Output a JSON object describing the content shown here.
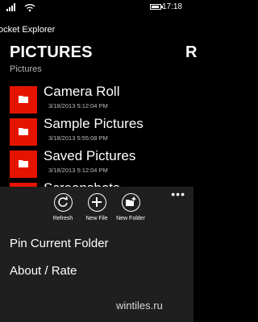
{
  "status": {
    "time": "17:18",
    "battery_level": 0.85
  },
  "app": {
    "title": "ocket Explorer"
  },
  "pivot": {
    "current": "PICTURES",
    "next": "R"
  },
  "breadcrumb": "Pictures",
  "folders": [
    {
      "name": "Camera Roll",
      "date": "3/18/2013 5:12:04 PM"
    },
    {
      "name": "Sample Pictures",
      "date": "3/18/2013 5:55:08 PM"
    },
    {
      "name": "Saved Pictures",
      "date": "3/18/2013 5:12:04 PM"
    },
    {
      "name": "Screenshots",
      "date": ""
    }
  ],
  "app_bar": {
    "ellipsis": "•••",
    "buttons": [
      {
        "label": "Refresh",
        "icon": "refresh-icon"
      },
      {
        "label": "New File",
        "icon": "plus-icon"
      },
      {
        "label": "New Folder",
        "icon": "new-folder-icon"
      }
    ],
    "menu": [
      {
        "label": "Pin Current Folder"
      },
      {
        "label": "About / Rate"
      }
    ]
  },
  "watermark": "wintiles.ru",
  "colors": {
    "accent": "#e51400",
    "appbar": "#1f1f1f",
    "background": "#000000"
  }
}
